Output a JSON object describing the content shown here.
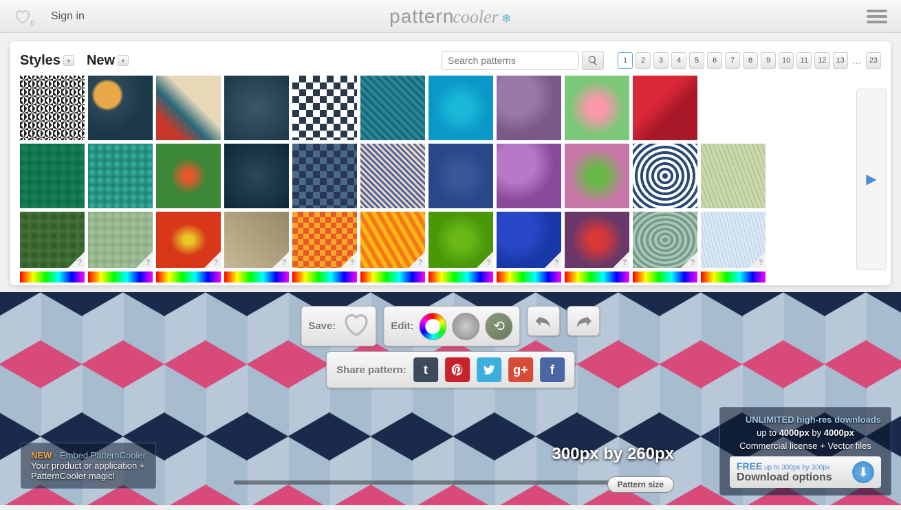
{
  "header": {
    "heartCount": "0",
    "signin": "Sign in",
    "logo1": "pattern",
    "logo2": "cooler"
  },
  "gallery": {
    "stylesLabel": "Styles",
    "newLabel": "New",
    "searchPlaceholder": "Search patterns",
    "pages": [
      "1",
      "2",
      "3",
      "4",
      "5",
      "6",
      "7",
      "8",
      "9",
      "10",
      "11",
      "12",
      "13"
    ],
    "pagesLast": "23",
    "activePage": "1"
  },
  "toolbar": {
    "saveLabel": "Save:",
    "editLabel": "Edit:"
  },
  "share": {
    "label": "Share pattern:",
    "icons": {
      "tumblr": "t",
      "pinterest": "p",
      "twitter": "t",
      "gplus": "g+",
      "fb": "f"
    }
  },
  "embed": {
    "new": "NEW",
    "title": " - Embed PatternCooler",
    "line1": "Your product or application +",
    "line2": "PatternCooler magic!"
  },
  "size": {
    "display": "300px by 260px",
    "label": "Pattern size"
  },
  "download": {
    "unlimited": "UNLIMITED high-res downloads",
    "line1": "up to 4000px by 4000px",
    "line2": "Commercial license + Vector files",
    "free": "FREE",
    "freeSub": " up to 300px by 300px",
    "options": "Download options"
  }
}
